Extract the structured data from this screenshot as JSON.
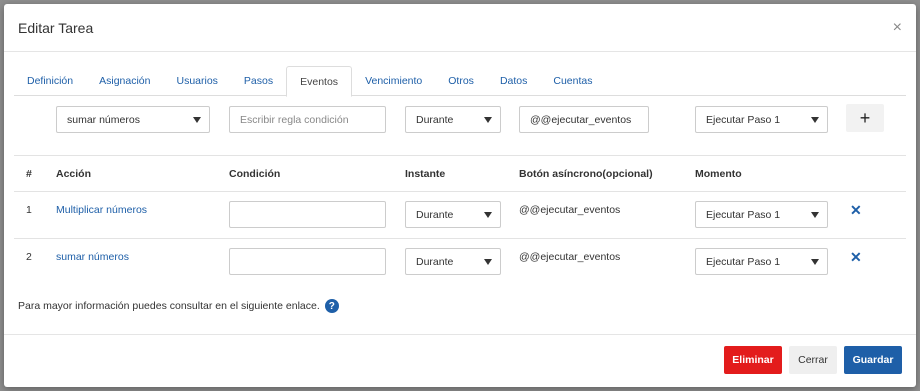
{
  "modal": {
    "title": "Editar Tarea",
    "close": "×"
  },
  "tabs": [
    "Definición",
    "Asignación",
    "Usuarios",
    "Pasos",
    "Eventos",
    "Vencimiento",
    "Otros",
    "Datos",
    "Cuentas"
  ],
  "active_tab": "Eventos",
  "form": {
    "action_value": "sumar números",
    "condition_placeholder": "Escribir regla condición",
    "instant_value": "Durante",
    "async_value": "@@ejecutar_eventos",
    "moment_value": "Ejecutar Paso 1",
    "add_label": "+"
  },
  "table": {
    "headers": {
      "num": "#",
      "action": "Acción",
      "condition": "Condición",
      "instant": "Instante",
      "async": "Botón asíncrono(opcional)",
      "moment": "Momento"
    },
    "rows": [
      {
        "num": "1",
        "action": "Multiplicar números",
        "condition": "",
        "instant": "Durante",
        "async": "@@ejecutar_eventos",
        "moment": "Ejecutar Paso 1",
        "delete": "✕"
      },
      {
        "num": "2",
        "action": "sumar números",
        "condition": "",
        "instant": "Durante",
        "async": "@@ejecutar_eventos",
        "moment": "Ejecutar Paso 1",
        "delete": "✕"
      }
    ]
  },
  "help": {
    "text": "Para mayor información puedes consultar en el siguiente enlace.",
    "icon": "?"
  },
  "footer": {
    "delete_label": "Eliminar",
    "close_label": "Cerrar",
    "save_label": "Guardar"
  },
  "colors": {
    "primary": "#1e5fa8",
    "danger": "#e31c1c"
  }
}
